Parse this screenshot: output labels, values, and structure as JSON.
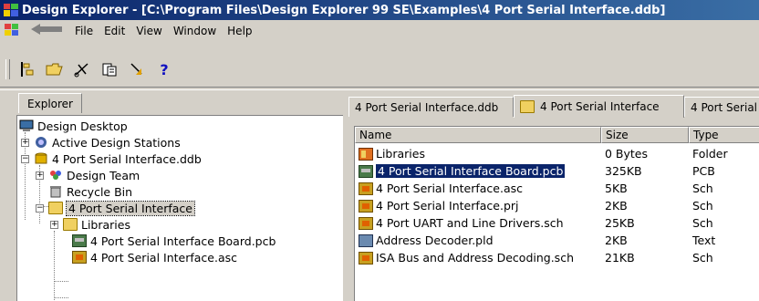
{
  "window": {
    "title": "Design Explorer - [C:\\Program Files\\Design Explorer 99 SE\\Examples\\4 Port Serial Interface.ddb]"
  },
  "menu": {
    "items": [
      "File",
      "Edit",
      "View",
      "Window",
      "Help"
    ]
  },
  "toolbar": {
    "buttons": [
      "explorer-toggle-icon",
      "open-folder-icon",
      "cut-icon",
      "paste-icon",
      "arrow-icon",
      "help-icon"
    ],
    "help_glyph": "?"
  },
  "explorer": {
    "tab_label": "Explorer",
    "tree": [
      {
        "label": "Design Desktop"
      },
      {
        "label": "Active Design Stations"
      },
      {
        "label": "4 Port Serial Interface.ddb"
      },
      {
        "label": "Design Team"
      },
      {
        "label": "Recycle Bin"
      },
      {
        "label": "4 Port Serial Interface"
      },
      {
        "label": "Libraries"
      },
      {
        "label": "4 Port Serial Interface Board.pcb"
      },
      {
        "label": "4 Port Serial Interface.asc"
      }
    ]
  },
  "document_tabs": [
    {
      "label": "4 Port Serial Interface.ddb"
    },
    {
      "label": "4 Port Serial Interface"
    },
    {
      "label": "4 Port Serial"
    }
  ],
  "file_list": {
    "columns": [
      "Name",
      "Size",
      "Type"
    ],
    "rows": [
      {
        "name": "Libraries",
        "size": "0 Bytes",
        "type": "Folder",
        "icon": "library-folder-icon"
      },
      {
        "name": "4 Port Serial Interface Board.pcb",
        "size": "325KB",
        "type": "PCB",
        "icon": "pcb-icon"
      },
      {
        "name": "4 Port Serial Interface.asc",
        "size": "5KB",
        "type": "Sch",
        "icon": "schematic-icon"
      },
      {
        "name": "4 Port Serial Interface.prj",
        "size": "2KB",
        "type": "Sch",
        "icon": "schematic-icon"
      },
      {
        "name": "4 Port UART and Line Drivers.sch",
        "size": "25KB",
        "type": "Sch",
        "icon": "schematic-icon"
      },
      {
        "name": "Address Decoder.pld",
        "size": "2KB",
        "type": "Text",
        "icon": "pld-icon"
      },
      {
        "name": "ISA Bus and Address Decoding.sch",
        "size": "21KB",
        "type": "Sch",
        "icon": "schematic-icon"
      }
    ]
  }
}
